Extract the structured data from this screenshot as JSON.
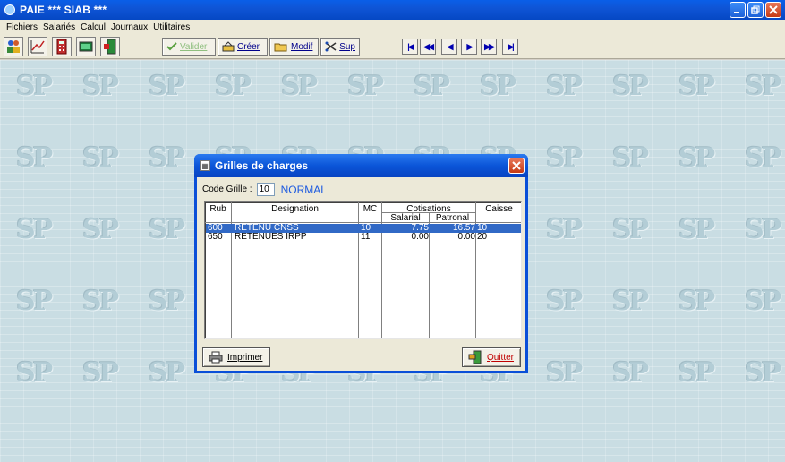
{
  "window": {
    "title": "PAIE *** SIAB ***"
  },
  "menu": [
    "Fichiers",
    "Salariés",
    "Calcul",
    "Journaux",
    "Utilitaires"
  ],
  "toolbar": {
    "left_icons": [
      "employees-icon",
      "chart-icon",
      "calculator-icon",
      "screen-icon",
      "exit-door-icon"
    ],
    "actions": [
      {
        "label": "Valider",
        "icon": "checkmark-icon",
        "enabled": false
      },
      {
        "label": "Créer",
        "icon": "create-icon",
        "enabled": true
      },
      {
        "label": "Modif",
        "icon": "folder-edit-icon",
        "enabled": true
      },
      {
        "label": "Sup",
        "icon": "scissors-icon",
        "enabled": true
      }
    ],
    "nav": [
      "first",
      "previous-page",
      "previous",
      "next",
      "next-page",
      "last"
    ]
  },
  "background": {
    "watermark": "SP"
  },
  "dialog": {
    "title": "Grilles de charges",
    "code_label": "Code Grille :",
    "code_value": "10",
    "code_name": "NORMAL",
    "columns": {
      "rub": "Rub",
      "designation": "Designation",
      "mc": "MC",
      "cotisations": "Cotisations",
      "salarial": "Salarial",
      "patronal": "Patronal",
      "caisse": "Caisse"
    },
    "rows": [
      {
        "rub": "600",
        "designation": "RETENU CNSS",
        "mc": "10",
        "salarial": "7.75",
        "patronal": "16.57",
        "caisse": "10",
        "selected": true
      },
      {
        "rub": "650",
        "designation": "RETENUES IRPP",
        "mc": "11",
        "salarial": "0.00",
        "patronal": "0.00",
        "caisse": "20",
        "selected": false
      }
    ],
    "print_label": "Imprimer",
    "quit_label": "Quitter"
  },
  "colors": {
    "selection": "#3169c6",
    "title_blue": "#0b55d8",
    "code_name": "#1c5ae0"
  }
}
